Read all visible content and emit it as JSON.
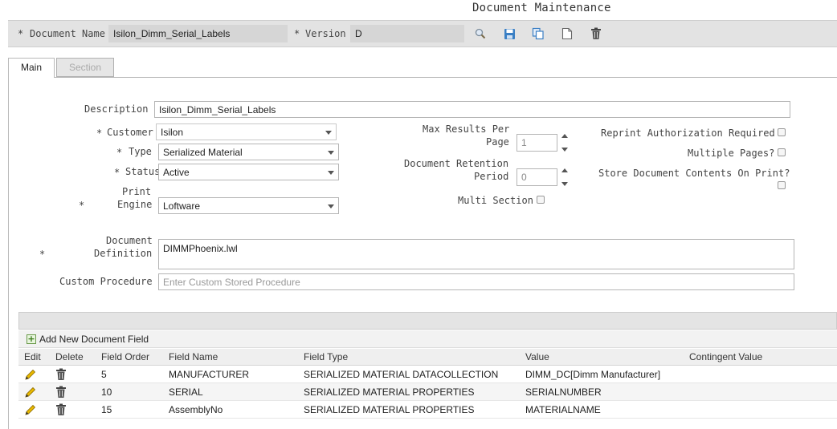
{
  "title": "Document Maintenance",
  "header": {
    "doc_name_label": "Document Name",
    "doc_name_value": "Isilon_Dimm_Serial_Labels",
    "version_label": "Version",
    "version_value": "D",
    "required_mark": "*",
    "toolbar_icons": [
      "search-icon",
      "save-icon",
      "copy-icon",
      "new-document-icon",
      "delete-icon"
    ]
  },
  "tabs": [
    {
      "label": "Main",
      "active": true
    },
    {
      "label": "Section",
      "active": false
    }
  ],
  "form": {
    "description_label": "Description",
    "description_value": "Isilon_Dimm_Serial_Labels",
    "customer_label": "Customer",
    "customer_value": "Isilon",
    "type_label": "Type",
    "type_value": "Serialized Material",
    "status_label": "Status",
    "status_value": "Active",
    "print_engine_label_1": "Print",
    "print_engine_label_2": "Engine",
    "print_engine_value": "Loftware",
    "max_results_label_1": "Max Results Per",
    "max_results_label_2": "Page",
    "max_results_value": "1",
    "retention_label_1": "Document Retention",
    "retention_label_2": "Period",
    "retention_value": "0",
    "multi_section_label": "Multi Section",
    "reprint_label": "Reprint Authorization Required",
    "multiple_pages_label": "Multiple Pages?",
    "store_contents_label": "Store Document Contents On Print?",
    "definition_label_1": "Document",
    "definition_label_2": "Definition",
    "definition_value": "DIMMPhoenix.lwl",
    "custom_procedure_label": "Custom Procedure",
    "custom_procedure_placeholder": "Enter Custom Stored Procedure"
  },
  "grid": {
    "add_button_label": "Add New Document Field",
    "columns": [
      "Edit",
      "Delete",
      "Field Order",
      "Field Name",
      "Field Type",
      "Value",
      "Contingent Value"
    ],
    "rows": [
      {
        "order": "5",
        "name": "MANUFACTURER",
        "type": "SERIALIZED MATERIAL DATACOLLECTION",
        "value": "DIMM_DC[Dimm Manufacturer]",
        "contingent": ""
      },
      {
        "order": "10",
        "name": "SERIAL",
        "type": "SERIALIZED MATERIAL PROPERTIES",
        "value": "SERIALNUMBER",
        "contingent": ""
      },
      {
        "order": "15",
        "name": "AssemblyNo",
        "type": "SERIALIZED MATERIAL PROPERTIES",
        "value": "MATERIALNAME",
        "contingent": ""
      }
    ]
  },
  "colors": {
    "required": "#c00000",
    "header_bg": "#e3e3e3",
    "edit_icon": "#d9a400",
    "toolbar_icon_blue": "#3a7fc4"
  }
}
